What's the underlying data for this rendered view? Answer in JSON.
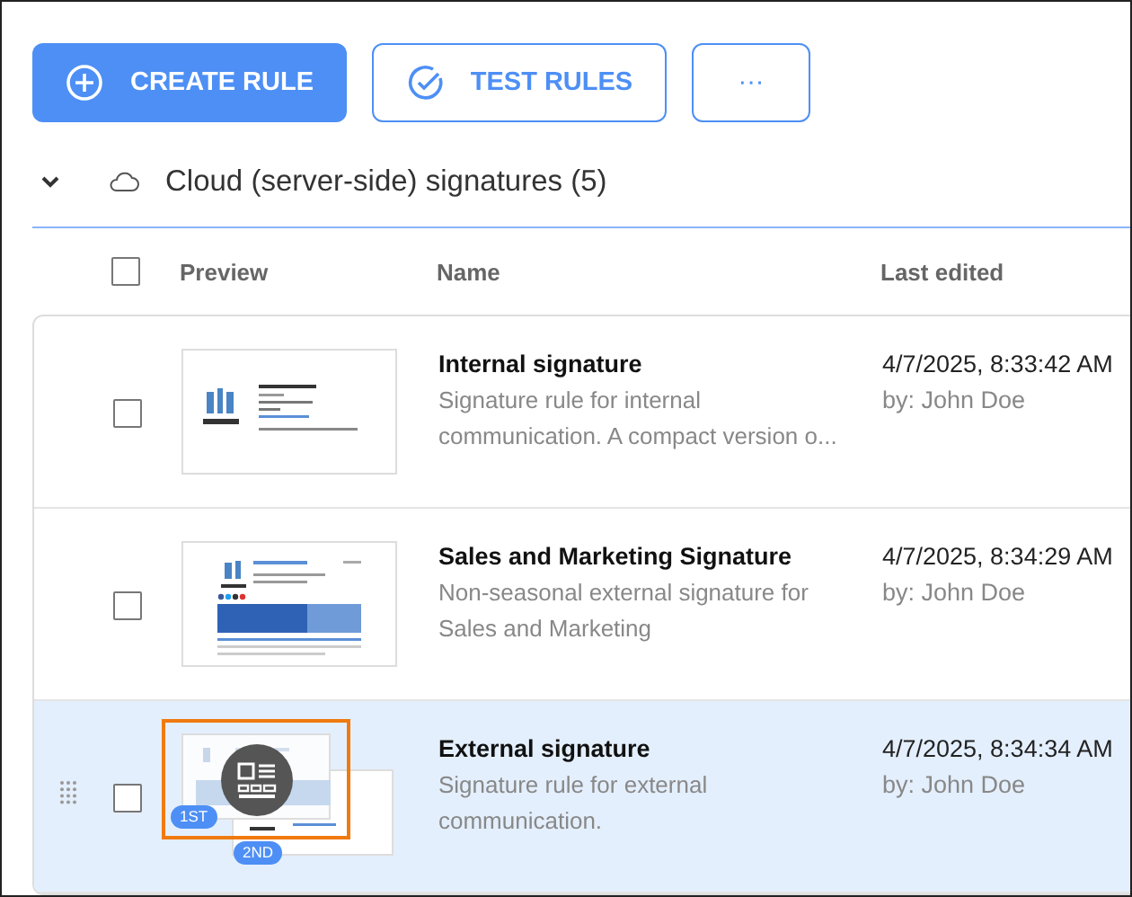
{
  "toolbar": {
    "buttons": [
      {
        "label": "CREATE RULE",
        "kind": "primary"
      },
      {
        "label": "TEST RULES",
        "kind": "outline"
      },
      {
        "label": "···",
        "kind": "more"
      }
    ]
  },
  "group": {
    "title": "Cloud (server-side) signatures (5)",
    "expanded": true
  },
  "table": {
    "columns": [
      "Preview",
      "Name",
      "Last edited"
    ],
    "header_checked": false,
    "rows": [
      {
        "kind": "compact",
        "name": "Internal signature",
        "description": "Signature rule for internal communication. A compact version o...",
        "date": "4/7/2025, 8:33:42 AM",
        "author": "by: John Doe",
        "checked": false,
        "selected": false
      },
      {
        "kind": "banner",
        "name": "Sales and Marketing Signature",
        "description": "Non-seasonal external signature for Sales and Marketing",
        "date": "4/7/2025, 8:34:29 AM",
        "author": "by: John Doe",
        "checked": false,
        "selected": false
      },
      {
        "kind": "stacked",
        "name": "External signature",
        "description": "Signature rule for external communication.",
        "date": "4/7/2025, 8:34:34 AM",
        "author": "by: John Doe",
        "checked": false,
        "selected": true,
        "badges": [
          "1ST",
          "2ND"
        ]
      }
    ]
  }
}
